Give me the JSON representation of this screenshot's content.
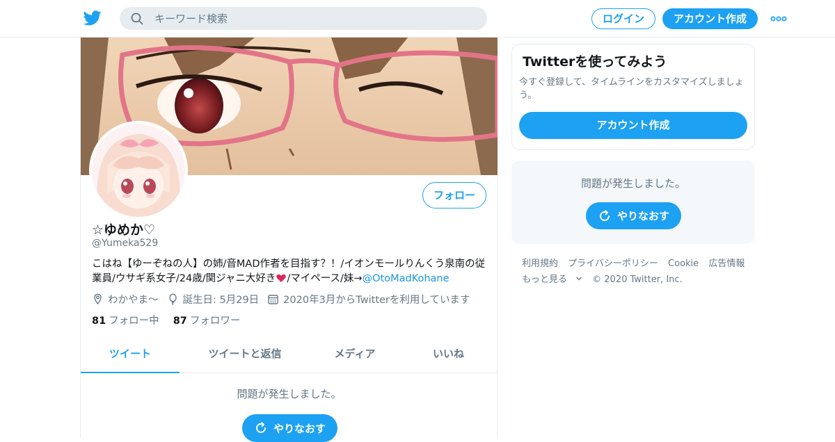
{
  "header": {
    "search_placeholder": "キーワード検索",
    "login_label": "ログイン",
    "signup_label": "アカウント作成"
  },
  "profile": {
    "display_name": "☆ゆめか♡",
    "handle": "@Yumeka529",
    "follow_label": "フォロー",
    "bio_part1": "こはね【ゆーぞねの人】の姉/音MAD作者を目指す？！/イオンモールりんくう泉南の従業員/ウサギ系女子/24歳/関ジャニ大好き",
    "bio_part2": "/マイペース/妹→",
    "bio_link": "@OtoMadKohane",
    "location": "わかやま〜",
    "birthday": "誕生日: 5月29日",
    "joined": "2020年3月からTwitterを利用しています",
    "following_count": "81",
    "following_label": "フォロー中",
    "followers_count": "87",
    "followers_label": "フォロワー"
  },
  "tabs": [
    {
      "label": "ツイート"
    },
    {
      "label": "ツイートと返信"
    },
    {
      "label": "メディア"
    },
    {
      "label": "いいね"
    }
  ],
  "timeline": {
    "error_message": "問題が発生しました。",
    "retry_label": "やりなおす"
  },
  "sidebar": {
    "signup_card": {
      "title": "Twitterを使ってみよう",
      "description": "今すぐ登録して、タイムラインをカスタマイズしましょう。",
      "cta_label": "アカウント作成"
    },
    "error_card": {
      "message": "問題が発生しました。",
      "retry_label": "やりなおす"
    },
    "footer": {
      "links": [
        "利用規約",
        "プライバシーポリシー",
        "Cookie",
        "広告情報"
      ],
      "more_label": "もっと見る",
      "copyright": "© 2020 Twitter, Inc."
    }
  },
  "colors": {
    "accent": "#1da1f2",
    "text_secondary": "#657786",
    "border": "#e6ecf0"
  }
}
